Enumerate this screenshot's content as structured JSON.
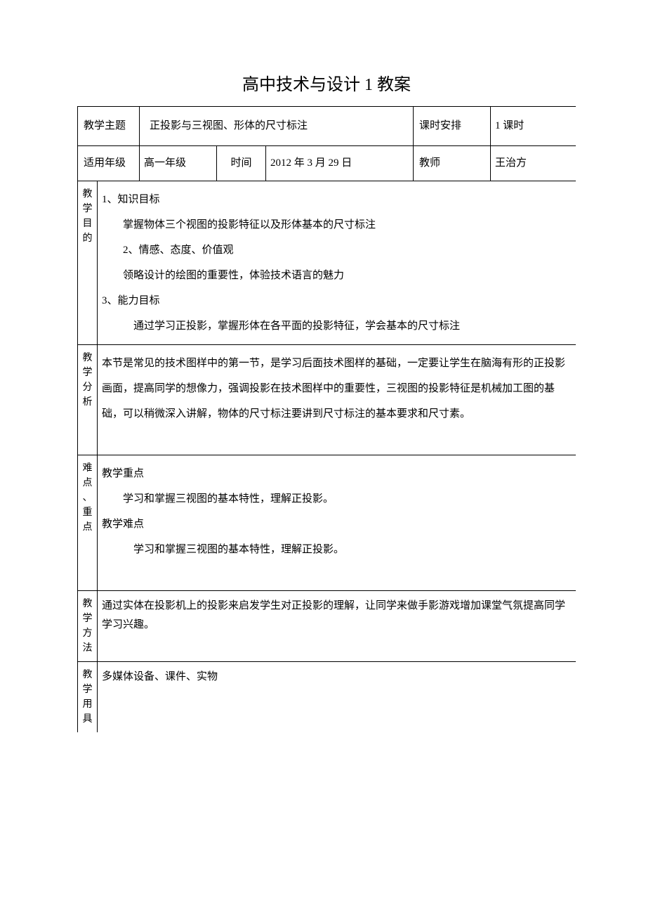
{
  "title": "高中技术与设计 1 教案",
  "hdr": {
    "topic_label": "教学主题",
    "topic_value": "正投影与三视图、形体的尺寸标注",
    "hours_label": "课时安排",
    "hours_value": "1 课时",
    "grade_label": "适用年级",
    "grade_value": "高一年级",
    "time_label": "时间",
    "time_value": "2012 年 3 月 29 日",
    "teacher_label": "教师",
    "teacher_value": "王治方"
  },
  "sections": {
    "goals_label": "教学目的",
    "goals": {
      "l1": "1、知识目标",
      "l1_1": "掌握物体三个视图的投影特征以及形体基本的尺寸标注",
      "l2": "2、情感、态度、价值观",
      "l2_1": "领略设计的绘图的重要性，体验技术语言的魅力",
      "l3": "3、能力目标",
      "l3_1": "通过学习正投影，掌握形体在各平面的投影特征，学会基本的尺寸标注"
    },
    "analysis_label": "教学分析",
    "analysis_text": "本节是常见的技术图样中的第一节，是学习后面技术图样的基础，一定要让学生在脑海有形的正投影画面，提高同学的想像力，强调投影在技术图样中的重要性，三视图的投影特征是机械加工图的基础，可以稍微深入讲解，物体的尺寸标注要讲到尺寸标注的基本要求和尺寸素。",
    "diff_label": "难点、重点",
    "diff": {
      "l1": "教学重点",
      "l1_1": "学习和掌握三视图的基本特性，理解正投影。",
      "l2": "教学难点",
      "l2_1": "学习和掌握三视图的基本特性，理解正投影。"
    },
    "method_label": "教学方法",
    "method_text": "通过实体在投影机上的投影来启发学生对正投影的理解，让同学来做手影游戏增加课堂气氛提高同学学习兴趣。",
    "tools_label": "教学用具",
    "tools_text": "多媒体设备、课件、实物"
  }
}
